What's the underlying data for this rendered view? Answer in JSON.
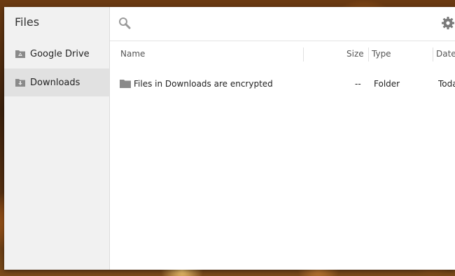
{
  "app": {
    "title": "Files"
  },
  "sidebar": {
    "items": [
      {
        "label": "Google Drive",
        "icon": "google-drive-icon",
        "selected": false
      },
      {
        "label": "Downloads",
        "icon": "downloads-icon",
        "selected": true
      }
    ]
  },
  "toolbar": {
    "search_icon": "search-icon",
    "settings_icon": "gear-icon"
  },
  "file_list": {
    "columns": [
      {
        "key": "name",
        "label": "Name"
      },
      {
        "key": "size",
        "label": "Size"
      },
      {
        "key": "type",
        "label": "Type"
      },
      {
        "key": "date",
        "label": "Date"
      }
    ],
    "rows": [
      {
        "name": "Files in Downloads are encrypted",
        "size": "--",
        "type": "Folder",
        "date": "Toda"
      }
    ]
  },
  "colors": {
    "sidebar_bg": "#f1f1f1",
    "selected_item_bg": "#e1e1e1",
    "icon_gray": "#8a8a8a"
  }
}
